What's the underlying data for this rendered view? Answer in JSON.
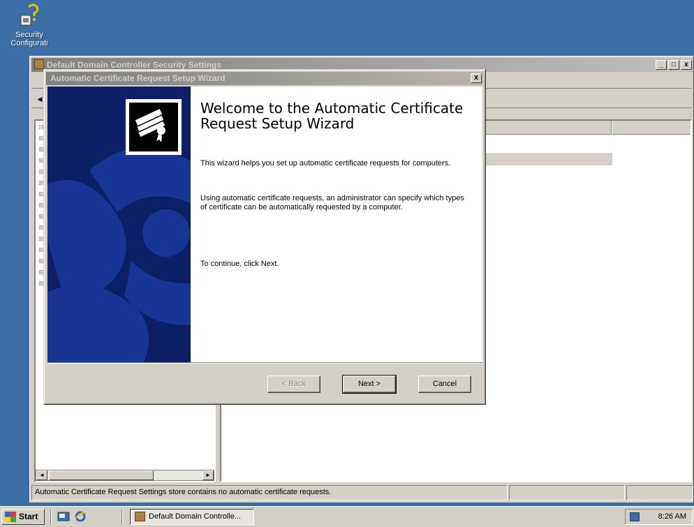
{
  "desktop": {
    "icons": [
      {
        "label": "Security Configurati",
        "icon": "security-config-icon"
      }
    ]
  },
  "mmc": {
    "title": "Default Domain Controller Security Settings",
    "window_buttons": [
      "_",
      "□",
      "x"
    ],
    "status_text": "Automatic Certificate Request Settings store contains no automatic certificate requests."
  },
  "wizard": {
    "title": "Automatic Certificate Request Setup Wizard",
    "close_label": "x",
    "heading": "Welcome to the Automatic Certificate Request Setup Wizard",
    "paragraph1": "This wizard helps you set up automatic certificate requests for computers.",
    "paragraph2": "Using automatic certificate requests, an administrator can specify which types of certificate can be automatically requested by a computer.",
    "paragraph3": "To continue, click Next.",
    "buttons": {
      "back": "< Back",
      "next": "Next >",
      "cancel": "Cancel"
    },
    "banner_color": "#0b1e66"
  },
  "taskbar": {
    "start_label": "Start",
    "task_label": "Default Domain Controlle...",
    "clock": "8:26 AM"
  }
}
